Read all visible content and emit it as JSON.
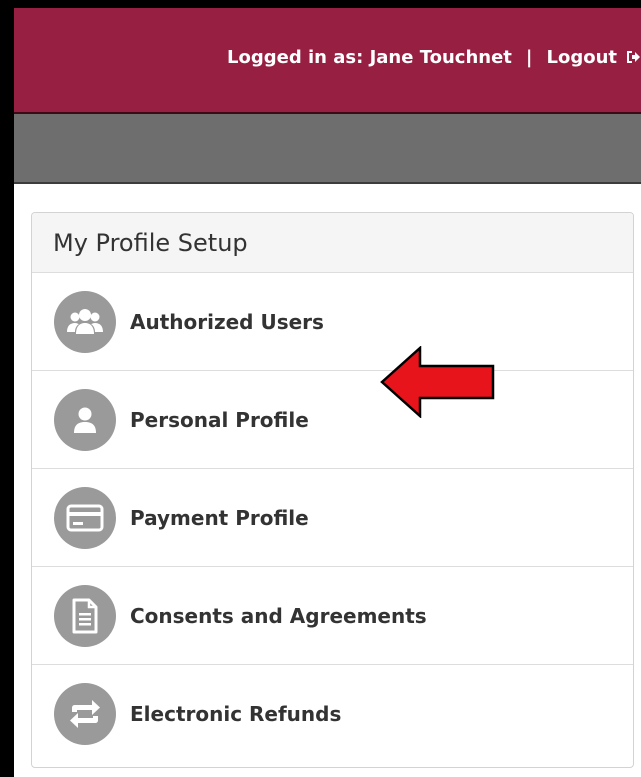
{
  "header": {
    "logged_in_text": "Logged in as: Jane Touchnet",
    "separator": "|",
    "logout_label": "Logout",
    "logout_icon": "sign-out-icon",
    "bg_color": "#972042"
  },
  "subnav": {
    "bg_color": "#6e6e6e"
  },
  "panel": {
    "title": "My Profile Setup",
    "items": [
      {
        "label": "Authorized Users",
        "icon": "users-icon"
      },
      {
        "label": "Personal Profile",
        "icon": "user-icon"
      },
      {
        "label": "Payment Profile",
        "icon": "credit-card-icon"
      },
      {
        "label": "Consents and Agreements",
        "icon": "document-icon"
      },
      {
        "label": "Electronic Refunds",
        "icon": "refresh-icon"
      }
    ]
  },
  "annotation": {
    "arrow_color": "#e8141b",
    "points_to": "Personal Profile"
  }
}
